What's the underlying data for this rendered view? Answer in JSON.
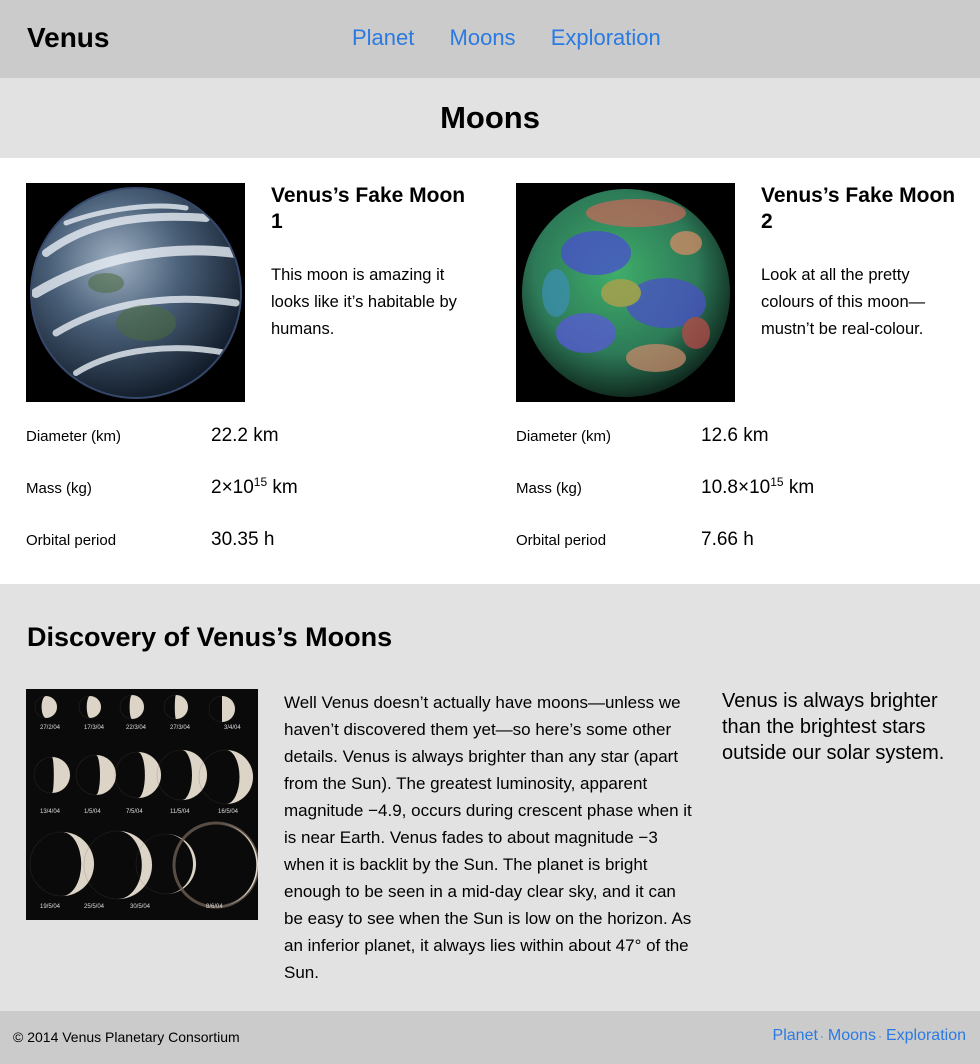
{
  "header": {
    "brand": "Venus",
    "nav": [
      "Planet",
      "Moons",
      "Exploration"
    ]
  },
  "page_title": "Moons",
  "moons": [
    {
      "name": "Venus’s Fake Moon 1",
      "description": "This moon is amazing it looks like it’s habitable by humans.",
      "image_icon": "earthlike-moon-image",
      "stats": [
        {
          "label": "Diameter (km)",
          "value": "22.2 km"
        },
        {
          "label": "Mass (kg)",
          "value_base": "2×10",
          "value_exp": "15",
          "value_unit": " km"
        },
        {
          "label": "Orbital period",
          "value": "30.35 h"
        }
      ]
    },
    {
      "name": "Venus’s Fake Moon 2",
      "description": "Look at all the pretty colours of this moon—mustn’t be real-colour.",
      "image_icon": "false-colour-moon-image",
      "stats": [
        {
          "label": "Diameter (km)",
          "value": "12.6 km"
        },
        {
          "label": "Mass (kg)",
          "value_base": "10.8×10",
          "value_exp": "15",
          "value_unit": " km"
        },
        {
          "label": "Orbital period",
          "value": "7.66 h"
        }
      ]
    }
  ],
  "discovery": {
    "heading": "Discovery of Venus’s Moons",
    "phase_labels": [
      "27/2/04",
      "17/3/04",
      "22/3/04",
      "27/3/04",
      "3/4/04",
      "13/4/04",
      "1/5/04",
      "7/5/04",
      "11/5/04",
      "16/5/04",
      "19/5/04",
      "25/5/04",
      "30/5/04",
      "8/6/04"
    ],
    "body": "Well Venus doesn’t actually have moons—unless we haven’t discovered them yet—so here’s some other details. Venus is always brighter than any star (apart from the Sun). The greatest luminosity, apparent magnitude −4.9, occurs during crescent phase when it is near Earth. Venus fades to about magnitude −3 when it is backlit by the Sun. The planet is bright enough to be seen in a mid-day clear sky, and it can be easy to see when the Sun is low on the horizon. As an inferior planet, it always lies within about 47° of the Sun.",
    "callout": "Venus is always brighter than the brightest stars outside our solar system."
  },
  "footer": {
    "copyright": "© 2014 Venus Planetary Consortium",
    "nav": [
      "Planet",
      "Moons",
      "Exploration"
    ],
    "separator": "·"
  },
  "colors": {
    "link": "#2a7ae2",
    "header_bg": "#cbcbcb",
    "band_bg": "#e2e2e2"
  }
}
